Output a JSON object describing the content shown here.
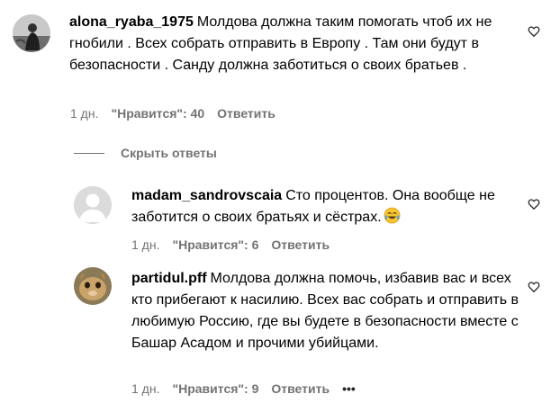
{
  "comments": [
    {
      "username": "alona_ryaba_1975",
      "text": "Молдова должна таким помогать чтоб их не гнобили . Всех собрать отправить в Европу . Там они будут в безопасности . Санду должна заботиться о своих братьев .",
      "time": "1 дн.",
      "likes": "\"Нравится\": 40",
      "reply_label": "Ответить",
      "avatar_icon": "user-photo-avatar"
    }
  ],
  "hide_replies_label": "Скрыть ответы",
  "replies": [
    {
      "username": "madam_sandrovscaia",
      "text": "Сто процентов. Она вообще не заботится о своих братьях и сёстрах.",
      "emoji": "tears-of-joy-emoji",
      "time": "1 дн.",
      "likes": "\"Нравится\": 6",
      "reply_label": "Ответить",
      "avatar_icon": "default-user-avatar"
    },
    {
      "username": "partidul.pff",
      "text": "Молдова должна помочь, избавив вас и всех кто прибегают к насилию. Всех вас собрать и отправить в любимую Россию, где вы будете в безопасности вместе с Башар Асадом и прочими убийцами.",
      "time": "1 дн.",
      "likes": "\"Нравится\": 9",
      "reply_label": "Ответить",
      "more_label": "•••",
      "avatar_icon": "user-photo-avatar"
    }
  ],
  "colors": {
    "text": "#000000",
    "secondary": "#737373",
    "background": "#ffffff"
  }
}
